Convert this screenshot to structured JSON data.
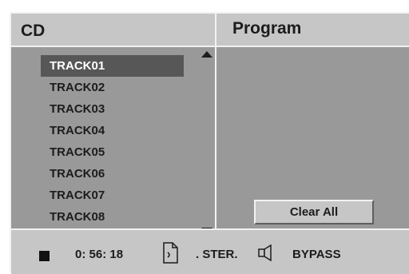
{
  "header": {
    "source_label": "CD",
    "program_label": "Program"
  },
  "tracks": [
    {
      "label": "TRACK01",
      "selected": true
    },
    {
      "label": "TRACK02",
      "selected": false
    },
    {
      "label": "TRACK03",
      "selected": false
    },
    {
      "label": "TRACK04",
      "selected": false
    },
    {
      "label": "TRACK05",
      "selected": false
    },
    {
      "label": "TRACK06",
      "selected": false
    },
    {
      "label": "TRACK07",
      "selected": false
    },
    {
      "label": "TRACK08",
      "selected": false
    }
  ],
  "program": {
    "clear_all_label": "Clear All"
  },
  "status": {
    "playback_icon": "stop-icon",
    "time": "0: 56: 18",
    "audio_icon": "audio-channel-icon",
    "audio_mode": ". STER.",
    "sound_icon": "speaker-icon",
    "sound_mode": "BYPASS"
  },
  "colors": {
    "panel": "#999999",
    "header_bar": "#c6c6c6",
    "highlight": "#575757",
    "bevel_light": "#f2f2f2",
    "text": "#1c1c1c"
  }
}
